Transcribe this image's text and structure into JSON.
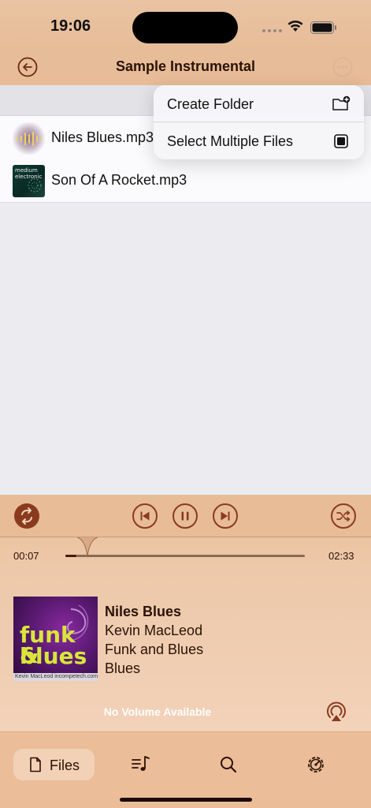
{
  "status_bar": {
    "time": "19:06"
  },
  "nav": {
    "title": "Sample Instrumental",
    "back_icon": "back-arrow-icon",
    "more_icon": "more-icon"
  },
  "files": [
    {
      "name": "Niles Blues.mp3",
      "thumb_icon": "waveform-thumbnail"
    },
    {
      "name": "Son Of A Rocket.mp3",
      "thumb_text": "medium electronic"
    }
  ],
  "menu": {
    "create_folder": "Create Folder",
    "select_multiple": "Select Multiple Files"
  },
  "player": {
    "elapsed": "00:07",
    "duration": "02:33",
    "progress": 0.046,
    "title": "Niles Blues",
    "artist": "Kevin MacLeod",
    "album": "Funk and Blues",
    "genre": "Blues",
    "artwork": {
      "line1": "funk &",
      "line2": "blues",
      "caption": "Kevin MacLeod incompetech.com"
    },
    "volume_text": "No Volume Available"
  },
  "tabs": {
    "files_label": "Files"
  },
  "colors": {
    "accent": "#8a3b1e",
    "bar": "#e8bc96",
    "text_dark": "#2a1206"
  }
}
